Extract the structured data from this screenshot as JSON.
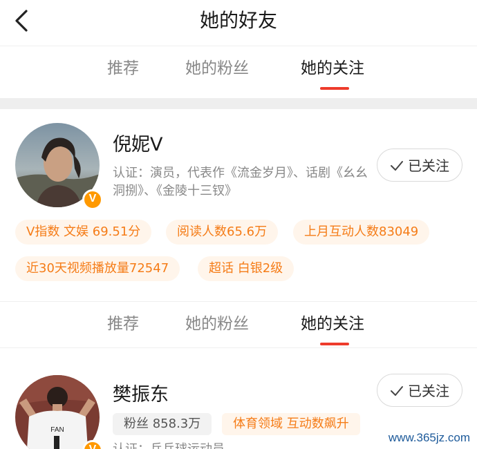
{
  "header": {
    "title": "她的好友",
    "back_icon": "chevron-left-icon"
  },
  "tabs": [
    {
      "label": "推荐",
      "active": false
    },
    {
      "label": "她的粉丝",
      "active": false
    },
    {
      "label": "她的关注",
      "active": true
    }
  ],
  "cards": [
    {
      "name": "倪妮V",
      "verified_badge": "V",
      "verification": "认证：演员，代表作《流金岁月》、话剧《幺幺洞捌》、《金陵十三钗》",
      "follow_label": "已关注",
      "tags": [
        "V指数 文娱 69.51分",
        "阅读人数65.6万",
        "上月互动人数83049",
        "近30天视频播放量72547",
        "超话 白银2级"
      ]
    },
    {
      "name": "樊振东",
      "verified_badge": "V",
      "verification": "认证：乒乓球运动员",
      "follow_label": "已关注",
      "fans_tag": "粉丝 858.3万",
      "tags": [
        "体育领域 互动数飙升"
      ],
      "avatar_jersey_text": "FAN"
    }
  ],
  "watermark": "www.365jz.com",
  "colors": {
    "accent": "#ee3b2b",
    "tag_text": "#f57c17",
    "tag_bg": "#fff5eb",
    "badge": "#ff9900"
  }
}
